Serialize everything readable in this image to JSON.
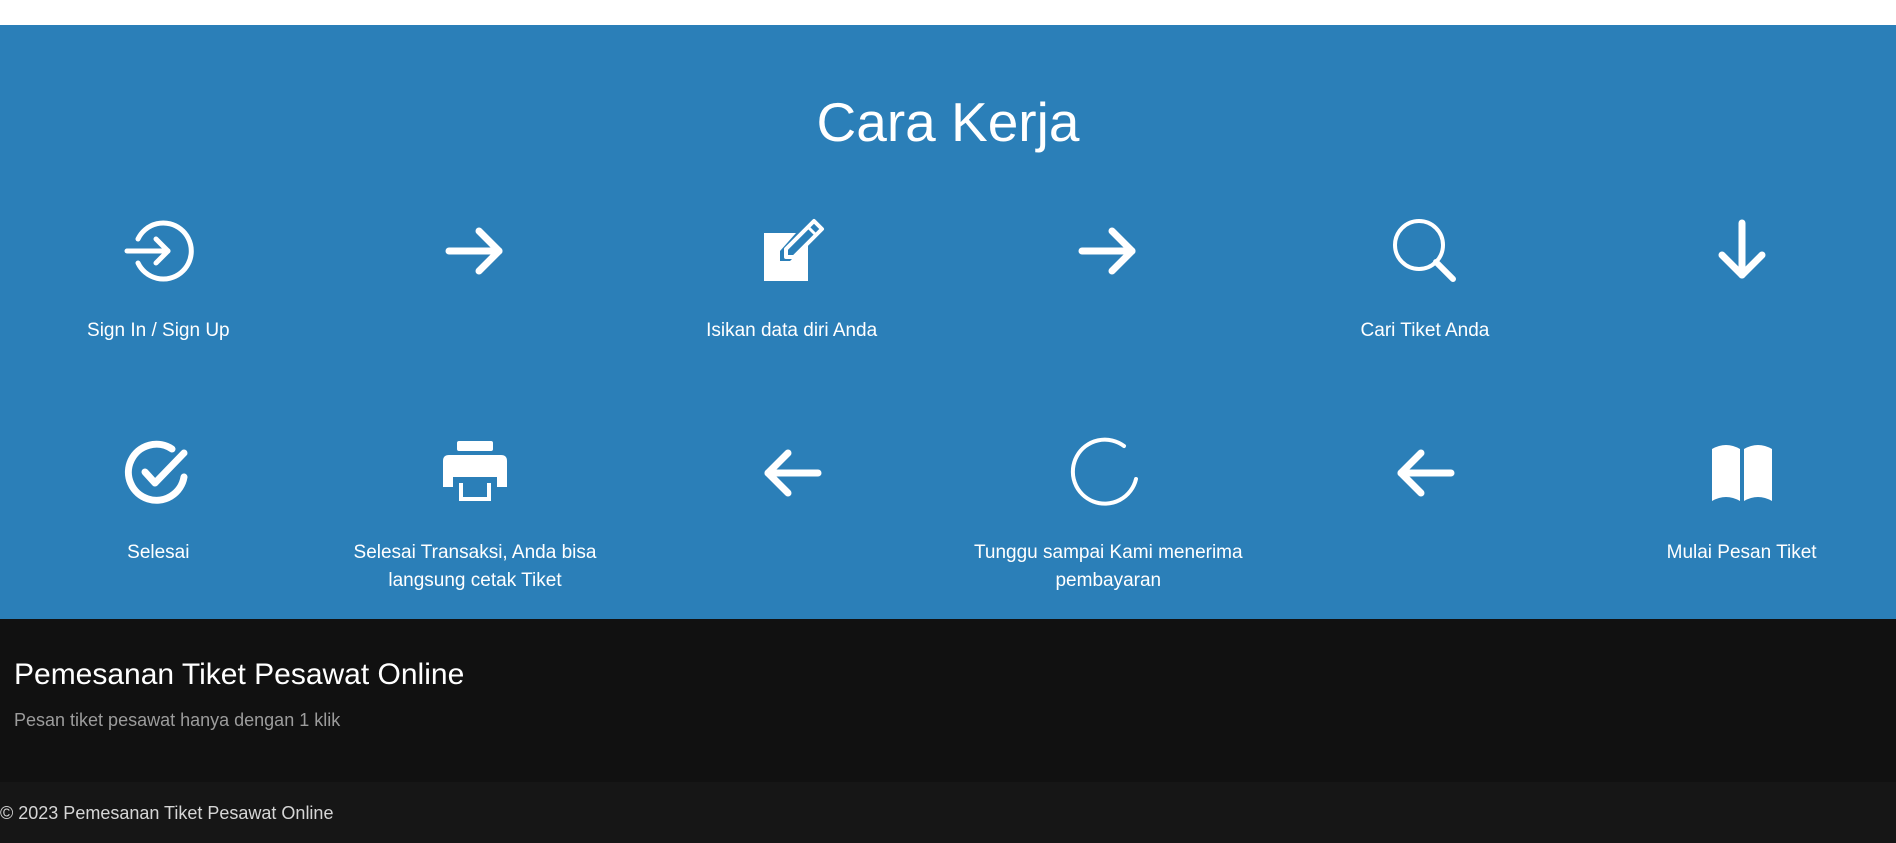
{
  "section": {
    "title": "Cara Kerja"
  },
  "steps_row1": [
    {
      "icon": "sign-in-icon",
      "label": "Sign In / Sign Up"
    },
    {
      "icon": "arrow-right-icon",
      "label": ""
    },
    {
      "icon": "edit-icon",
      "label": "Isikan data diri Anda"
    },
    {
      "icon": "arrow-right-icon",
      "label": ""
    },
    {
      "icon": "search-icon",
      "label": "Cari Tiket Anda"
    },
    {
      "icon": "arrow-down-icon",
      "label": ""
    }
  ],
  "steps_row2": [
    {
      "icon": "check-circle-icon",
      "label": "Selesai"
    },
    {
      "icon": "printer-icon",
      "label": "Selesai Transaksi, Anda bisa langsung cetak Tiket"
    },
    {
      "icon": "arrow-left-icon",
      "label": ""
    },
    {
      "icon": "loading-circle-icon",
      "label": "Tunggu sampai Kami menerima pembayaran"
    },
    {
      "icon": "arrow-left-icon",
      "label": ""
    },
    {
      "icon": "book-open-icon",
      "label": "Mulai Pesan Tiket"
    }
  ],
  "footer": {
    "title": "Pemesanan Tiket Pesawat Online",
    "tagline": "Pesan tiket pesawat hanya dengan 1 klik",
    "copyright": "© 2023 Pemesanan Tiket Pesawat Online"
  },
  "colors": {
    "section_background": "#2b7fb8",
    "footer_background": "#111111",
    "footer_bottom_background": "#161616",
    "icon_color": "#ffffff"
  }
}
